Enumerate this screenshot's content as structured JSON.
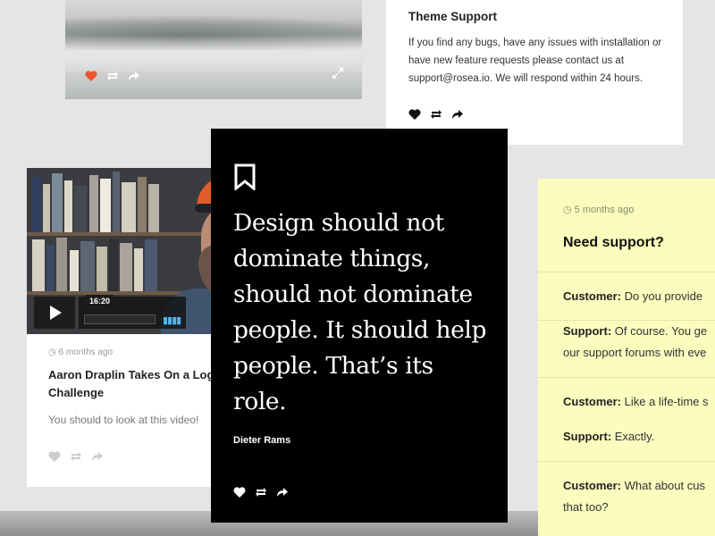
{
  "photo_card": {
    "actions": [
      "heart-icon",
      "repost-icon",
      "share-icon"
    ],
    "heart_color": "#e8562e",
    "expand_icon": "expand-icon"
  },
  "theme_card": {
    "title": "Theme Support",
    "body": "If you find any bugs, have any issues with installation or have new feature requests please contact us at support@rosea.io. We will respond within 24 hours.",
    "actions": [
      "heart-icon",
      "repost-icon",
      "share-icon"
    ]
  },
  "video_card": {
    "timestamp": "6 months ago",
    "video_time": "16:20",
    "title": "Aaron Draplin Takes On a Logo Challenge",
    "description": "You should to look at this video!",
    "actions": [
      "heart-icon",
      "repost-icon",
      "share-icon"
    ]
  },
  "quote_card": {
    "quote": "Design should not dominate things, should not dominate people. It should help people. That’s its role.",
    "author": "Dieter Rams",
    "actions": [
      "heart-icon",
      "repost-icon",
      "share-icon"
    ]
  },
  "support_card": {
    "timestamp": "5 months ago",
    "title": "Need support?",
    "messages": [
      {
        "speaker": "Customer:",
        "text": " Do you provide"
      },
      {
        "speaker": "Support:",
        "text": " Of course. You ge"
      },
      {
        "speaker": "",
        "text": "our support forums with eve"
      },
      {
        "speaker": "Customer:",
        "text": " Like a life-time s"
      },
      {
        "speaker": "Support:",
        "text": " Exactly."
      },
      {
        "speaker": "Customer:",
        "text": " What about cus"
      },
      {
        "speaker": "",
        "text": "that too?"
      }
    ],
    "background": "#fbfdbe"
  }
}
